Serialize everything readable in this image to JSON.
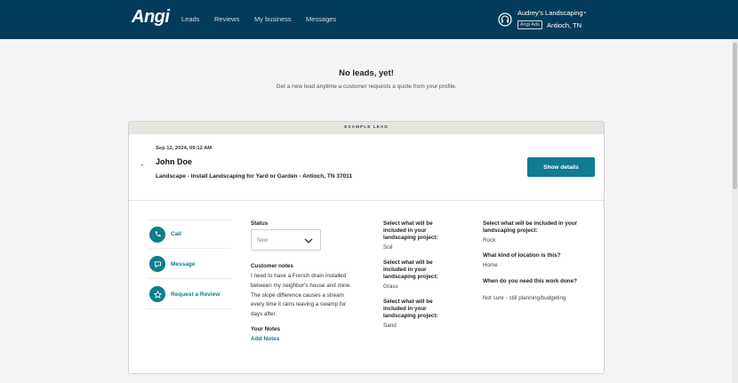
{
  "nav": {
    "logo": "Angi",
    "links": [
      "Leads",
      "Reviews",
      "My business",
      "Messages"
    ],
    "business_name": "Audrey's Landscaping",
    "badge": "Angi Ads",
    "location": "Antioch, TN"
  },
  "empty_state": {
    "title": "No leads, yet!",
    "subtitle": "Get a new lead anytime a customer requests a quote from your profile."
  },
  "lead": {
    "banner": "EXAMPLE LEAD",
    "date": "Sep 12, 2024, 09:12 AM",
    "name": "John Doe",
    "description": "Landscape - Install Landscaping for Yard or Garden - Antioch, TN 37011",
    "show_details_label": "Show details",
    "actions": [
      {
        "label": "Call",
        "icon": "phone-icon"
      },
      {
        "label": "Message",
        "icon": "chat-icon"
      },
      {
        "label": "Request a Review",
        "icon": "star-icon"
      }
    ],
    "status_label": "Status",
    "status_value": "New",
    "customer_notes_label": "Customer notes",
    "customer_notes": "I need to have a French drain installed between my neighbor's house and mine. The slope difference causes a stream every time it rains leaving a swamp for days after.",
    "your_notes_label": "Your Notes",
    "add_notes_label": "Add Notes",
    "questions_col1": [
      {
        "q": "Select what will be included in your landscaping project:",
        "a": "Soil"
      },
      {
        "q": "Select what will be included in your landscaping project:",
        "a": "Grass"
      },
      {
        "q": "Select what will be included in your landscaping project:",
        "a": "Sand"
      }
    ],
    "questions_col2": [
      {
        "q": "Select what will be included in your landscaping project:",
        "a": "Rock"
      },
      {
        "q": "What kind of location is this?",
        "a": "Home"
      },
      {
        "q": "When do you need this work done?",
        "a": "Not sure - still planning/budgeting"
      }
    ]
  },
  "colors": {
    "nav_bg": "#033c5a",
    "accent": "#0f7c8f"
  }
}
